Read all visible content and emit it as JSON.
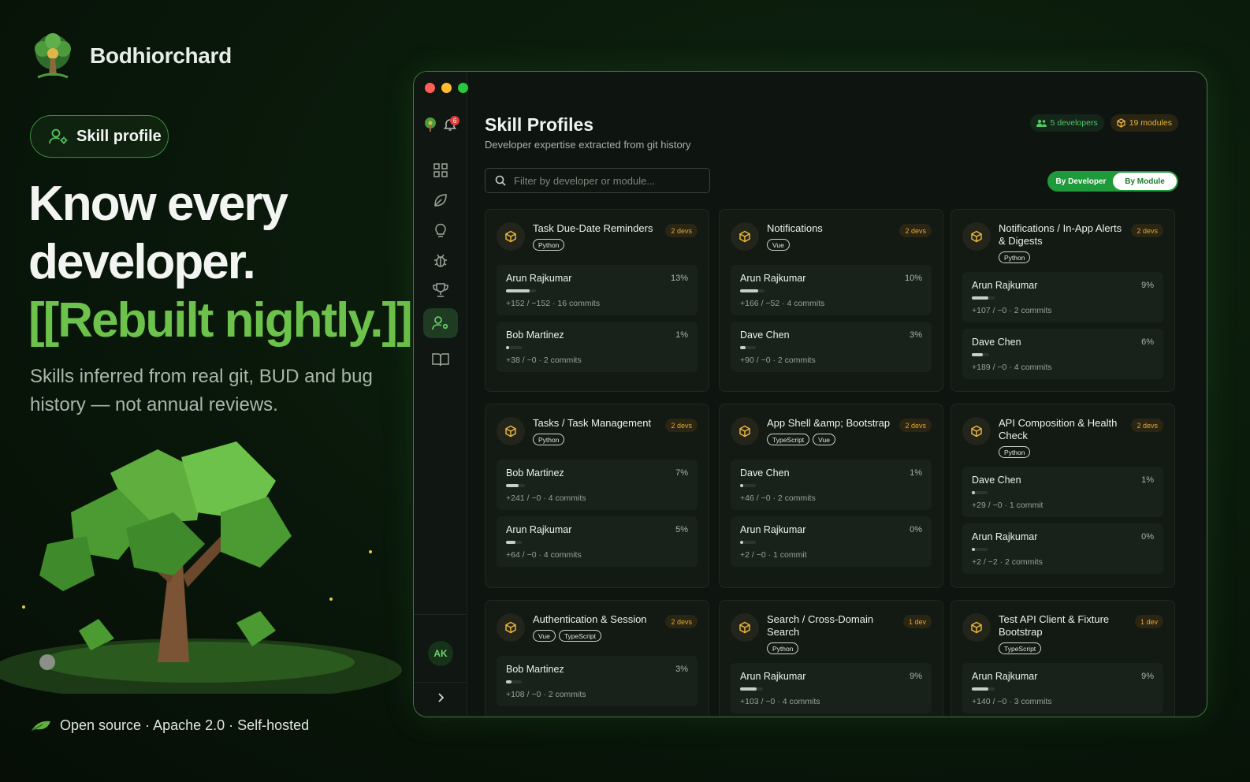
{
  "brand": {
    "name": "Bodhiorchard",
    "logo_icon": "tree-logo-icon"
  },
  "hero": {
    "pill_label": "Skill profile",
    "pill_icon": "user-gear-icon",
    "headline_line1": "Know every",
    "headline_line2": "developer.",
    "headline_accent": "[[Rebuilt nightly.]]",
    "subtext": "Skills inferred from real git, BUD and bug history — not annual reviews.",
    "footer": "Open source · Apache 2.0 · Self-hosted",
    "accent_color": "#6cc24a"
  },
  "window": {
    "traffic_lights": [
      "#ff5f57",
      "#febc2e",
      "#28c840"
    ],
    "notification_count": "6",
    "avatar_initials": "AK",
    "rail": [
      {
        "icon": "dashboard-grid-icon",
        "active": false
      },
      {
        "icon": "leaf-icon",
        "active": false
      },
      {
        "icon": "lightbulb-icon",
        "active": false
      },
      {
        "icon": "bug-icon",
        "active": false
      },
      {
        "icon": "trophy-icon",
        "active": false
      },
      {
        "icon": "user-gear-icon",
        "active": true
      },
      {
        "icon": "book-icon",
        "active": false
      }
    ]
  },
  "page": {
    "title": "Skill Profiles",
    "subtitle": "Developer expertise extracted from git history",
    "developers_chip": "5 developers",
    "modules_chip": "19 modules",
    "search_placeholder": "Filter by developer or module...",
    "toggle": {
      "by_developer": "By Developer",
      "by_module": "By Module",
      "selected": "By Module"
    }
  },
  "modules": [
    {
      "title": "Task Due-Date Reminders",
      "devs": "2 devs",
      "tags": [
        "Python"
      ],
      "contributors": [
        {
          "name": "Arun Rajkumar",
          "pct": "13%",
          "fill": 0.13,
          "meta": "+152 / −152 · 16 commits"
        },
        {
          "name": "Bob Martinez",
          "pct": "1%",
          "fill": 0.01,
          "meta": "+38 / −0 · 2 commits"
        }
      ]
    },
    {
      "title": "Notifications",
      "devs": "2 devs",
      "tags": [
        "Vue"
      ],
      "contributors": [
        {
          "name": "Arun Rajkumar",
          "pct": "10%",
          "fill": 0.1,
          "meta": "+166 / −52 · 4 commits"
        },
        {
          "name": "Dave Chen",
          "pct": "3%",
          "fill": 0.03,
          "meta": "+90 / −0 · 2 commits"
        }
      ]
    },
    {
      "title": "Notifications / In-App Alerts & Digests",
      "devs": "2 devs",
      "tags": [
        "Python"
      ],
      "contributors": [
        {
          "name": "Arun Rajkumar",
          "pct": "9%",
          "fill": 0.09,
          "meta": "+107 / −0 · 2 commits"
        },
        {
          "name": "Dave Chen",
          "pct": "6%",
          "fill": 0.06,
          "meta": "+189 / −0 · 4 commits"
        }
      ]
    },
    {
      "title": "Tasks / Task Management",
      "devs": "2 devs",
      "tags": [
        "Python"
      ],
      "contributors": [
        {
          "name": "Bob Martinez",
          "pct": "7%",
          "fill": 0.07,
          "meta": "+241 / −0 · 4 commits"
        },
        {
          "name": "Arun Rajkumar",
          "pct": "5%",
          "fill": 0.05,
          "meta": "+64 / −0 · 4 commits"
        }
      ]
    },
    {
      "title": "App Shell &amp; Bootstrap",
      "devs": "2 devs",
      "tags": [
        "TypeScript",
        "Vue"
      ],
      "contributors": [
        {
          "name": "Dave Chen",
          "pct": "1%",
          "fill": 0.01,
          "meta": "+46 / −0 · 2 commits"
        },
        {
          "name": "Arun Rajkumar",
          "pct": "0%",
          "fill": 0.0,
          "meta": "+2 / −0 · 1 commit"
        }
      ]
    },
    {
      "title": "API Composition & Health Check",
      "devs": "2 devs",
      "tags": [
        "Python"
      ],
      "contributors": [
        {
          "name": "Dave Chen",
          "pct": "1%",
          "fill": 0.01,
          "meta": "+29 / −0 · 1 commit"
        },
        {
          "name": "Arun Rajkumar",
          "pct": "0%",
          "fill": 0.0,
          "meta": "+2 / −2 · 2 commits"
        }
      ]
    },
    {
      "title": "Authentication & Session",
      "devs": "2 devs",
      "tags": [
        "Vue",
        "TypeScript"
      ],
      "contributors": [
        {
          "name": "Bob Martinez",
          "pct": "3%",
          "fill": 0.03,
          "meta": "+108 / −0 · 2 commits"
        }
      ]
    },
    {
      "title": "Search / Cross-Domain Search",
      "devs": "1 dev",
      "tags": [
        "Python"
      ],
      "contributors": [
        {
          "name": "Arun Rajkumar",
          "pct": "9%",
          "fill": 0.09,
          "meta": "+103 / −0 · 4 commits"
        }
      ]
    },
    {
      "title": "Test API Client & Fixture Bootstrap",
      "devs": "1 dev",
      "tags": [
        "TypeScript"
      ],
      "contributors": [
        {
          "name": "Arun Rajkumar",
          "pct": "9%",
          "fill": 0.09,
          "meta": "+140 / −0 · 3 commits"
        }
      ]
    }
  ]
}
